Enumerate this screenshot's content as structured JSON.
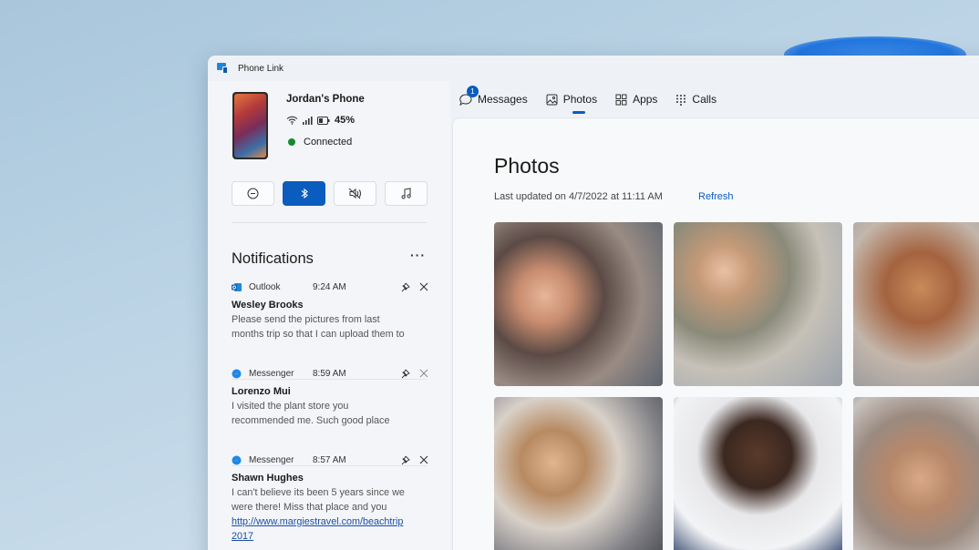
{
  "window": {
    "title": "Phone Link"
  },
  "phone": {
    "name": "Jordan's Phone",
    "battery": "45%",
    "status": "Connected"
  },
  "quick_actions": [
    {
      "name": "do-not-disturb",
      "active": false
    },
    {
      "name": "bluetooth",
      "active": true
    },
    {
      "name": "audio-mute",
      "active": false
    },
    {
      "name": "media",
      "active": false
    }
  ],
  "notifications": {
    "heading": "Notifications",
    "more_label": "···",
    "items": [
      {
        "app": "Outlook",
        "time": "9:24 AM",
        "sender": "Wesley Brooks",
        "lines": [
          "Please send the pictures from last",
          "months trip so that I can upload them to"
        ],
        "link": ""
      },
      {
        "app": "Messenger",
        "time": "8:59 AM",
        "sender": "Lorenzo Mui",
        "lines": [
          "I visited the plant store you",
          "recommended me. Such good place"
        ],
        "link": ""
      },
      {
        "app": "Messenger",
        "time": "8:57 AM",
        "sender": "Shawn Hughes",
        "lines": [
          "I can't believe its been 5 years since we",
          "were there! Miss that place and you"
        ],
        "link_lines": [
          "http://www.margiestravel.com/beachtrip",
          "2017"
        ]
      }
    ]
  },
  "tabs": [
    {
      "label": "Messages",
      "badge": "1"
    },
    {
      "label": "Photos",
      "selected": true
    },
    {
      "label": "Apps"
    },
    {
      "label": "Calls"
    }
  ],
  "photos_page": {
    "title": "Photos",
    "last_updated": "Last updated on 4/7/2022 at 11:11 AM",
    "refresh": "Refresh"
  },
  "colors": {
    "accent": "#0b5cbf",
    "connected": "#138a2e"
  }
}
